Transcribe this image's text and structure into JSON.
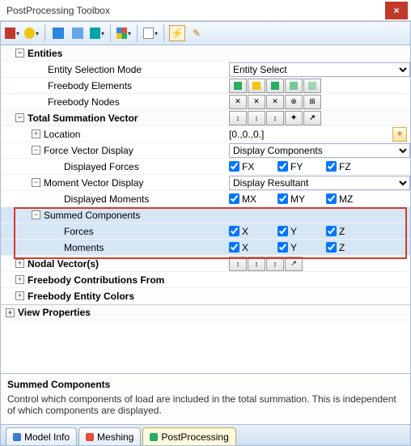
{
  "window": {
    "title": "PostProcessing Toolbox"
  },
  "tree": {
    "entities": {
      "label": "Entities",
      "entity_selection_mode": "Entity Selection Mode",
      "entity_select_value": "Entity Select",
      "freebody_elements": "Freebody Elements",
      "freebody_nodes": "Freebody Nodes"
    },
    "tsv": {
      "label": "Total Summation Vector",
      "location": {
        "label": "Location",
        "value": "[0.,0.,0.]"
      },
      "fvd": {
        "label": "Force Vector Display",
        "value": "Display Components"
      },
      "displayed_forces": {
        "label": "Displayed Forces",
        "fx": "FX",
        "fy": "FY",
        "fz": "FZ"
      },
      "mvd": {
        "label": "Moment Vector Display",
        "value": "Display Resultant"
      },
      "displayed_moments": {
        "label": "Displayed Moments",
        "mx": "MX",
        "my": "MY",
        "mz": "MZ"
      },
      "summed": {
        "label": "Summed Components",
        "forces": {
          "label": "Forces",
          "x": "X",
          "y": "Y",
          "z": "Z"
        },
        "moments": {
          "label": "Moments",
          "x": "X",
          "y": "Y",
          "z": "Z"
        }
      }
    },
    "nodal_vectors": "Nodal Vector(s)",
    "contributions_from": "Freebody Contributions From",
    "entity_colors": "Freebody Entity Colors",
    "view_properties": "View Properties"
  },
  "help": {
    "title": "Summed Components",
    "body": "Control which components of load are included in the total summation. This is independent of which components are displayed."
  },
  "tabs": {
    "model_info": "Model Info",
    "meshing": "Meshing",
    "postprocessing": "PostProcessing"
  }
}
